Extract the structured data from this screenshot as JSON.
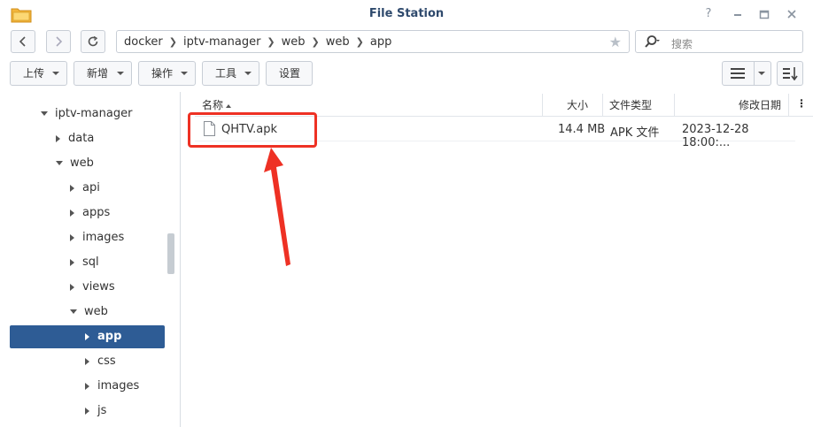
{
  "window": {
    "title": "File Station"
  },
  "icons": {
    "app": "folder-icon",
    "help": "help-icon",
    "minimize": "minimize-icon",
    "maximize": "maximize-icon",
    "close": "close-icon",
    "back": "chevron-left-icon",
    "forward": "chevron-right-icon",
    "refresh": "refresh-icon",
    "favorite": "star-icon",
    "search": "search-icon",
    "list_view": "list-view-icon",
    "sort": "sort-icon",
    "file": "file-icon"
  },
  "breadcrumb": [
    "docker",
    "iptv-manager",
    "web",
    "web",
    "app"
  ],
  "search": {
    "placeholder": "搜索"
  },
  "toolbar": {
    "upload": "上传",
    "create": "新增",
    "action": "操作",
    "tools": "工具",
    "settings": "设置"
  },
  "tree": {
    "items": [
      {
        "label": "iptv-manager",
        "level": 1,
        "state": "expanded"
      },
      {
        "label": "data",
        "level": 2,
        "state": "collapsed"
      },
      {
        "label": "web",
        "level": 2,
        "state": "expanded"
      },
      {
        "label": "api",
        "level": 3,
        "state": "collapsed"
      },
      {
        "label": "apps",
        "level": 3,
        "state": "collapsed"
      },
      {
        "label": "images",
        "level": 3,
        "state": "collapsed"
      },
      {
        "label": "sql",
        "level": 3,
        "state": "collapsed"
      },
      {
        "label": "views",
        "level": 3,
        "state": "collapsed"
      },
      {
        "label": "web",
        "level": 3,
        "state": "expanded"
      },
      {
        "label": "app",
        "level": 4,
        "state": "collapsed",
        "selected": true
      },
      {
        "label": "css",
        "level": 4,
        "state": "collapsed"
      },
      {
        "label": "images",
        "level": 4,
        "state": "collapsed"
      },
      {
        "label": "js",
        "level": 4,
        "state": "collapsed"
      }
    ]
  },
  "file_list": {
    "columns": {
      "name": "名称",
      "size": "大小",
      "type": "文件类型",
      "modified": "修改日期"
    },
    "sort_column": "name",
    "sort_direction": "ascending",
    "rows": [
      {
        "name": "QHTV.apk",
        "size": "14.4 MB",
        "type": "APK 文件",
        "modified": "2023-12-28 18:00:..."
      }
    ]
  },
  "annotation": {
    "color": "#ee3124"
  },
  "colors": {
    "accent": "#2e5c95",
    "title": "#2f4a6d"
  }
}
